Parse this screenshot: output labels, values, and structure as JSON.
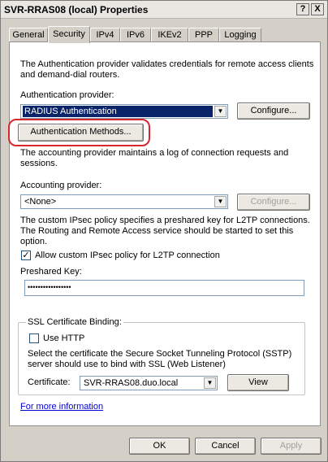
{
  "window": {
    "title": "SVR-RRAS08 (local) Properties",
    "help_glyph": "?",
    "close_glyph": "X"
  },
  "tabs": [
    {
      "label": "General"
    },
    {
      "label": "Security"
    },
    {
      "label": "IPv4"
    },
    {
      "label": "IPv6"
    },
    {
      "label": "IKEv2"
    },
    {
      "label": "PPP"
    },
    {
      "label": "Logging"
    }
  ],
  "active_tab": "Security",
  "authentication": {
    "description_line1": "The Authentication provider validates credentials for remote access clients",
    "description_line2": "and demand-dial routers.",
    "provider_label": "Authentication provider:",
    "provider_value": "RADIUS Authentication",
    "configure_label": "Configure...",
    "methods_label": "Authentication Methods..."
  },
  "accounting": {
    "description_line1": "The accounting provider maintains a log of connection requests and",
    "description_line2": "sessions.",
    "provider_label": "Accounting provider:",
    "provider_value": "<None>",
    "configure_label": "Configure..."
  },
  "ipsec": {
    "description_line1": "The custom IPsec policy specifies a preshared key for L2TP connections.",
    "description_line2": "The Routing and Remote Access service should be started to set this",
    "description_line3": "option.",
    "checkbox_label": "Allow custom IPsec policy for L2TP connection",
    "checkbox_checked": true,
    "checkbox_mark": "✓",
    "preshared_label": "Preshared Key:",
    "preshared_value": "•••••••••••••••••"
  },
  "ssl": {
    "group_label": "SSL Certificate Binding:",
    "use_http_label": "Use HTTP",
    "use_http_checked": false,
    "description_line1": "Select the certificate the Secure Socket Tunneling Protocol (SSTP)",
    "description_line2": "server should use to bind with SSL (Web Listener)",
    "certificate_label": "Certificate:",
    "certificate_value": "SVR-RRAS08.duo.local",
    "view_label": "View"
  },
  "more_info_link": "For more information",
  "footer": {
    "ok_label": "OK",
    "cancel_label": "Cancel",
    "apply_label": "Apply"
  },
  "annotation_color": "#d8262c",
  "dropdown_arrow_glyph": "▼"
}
